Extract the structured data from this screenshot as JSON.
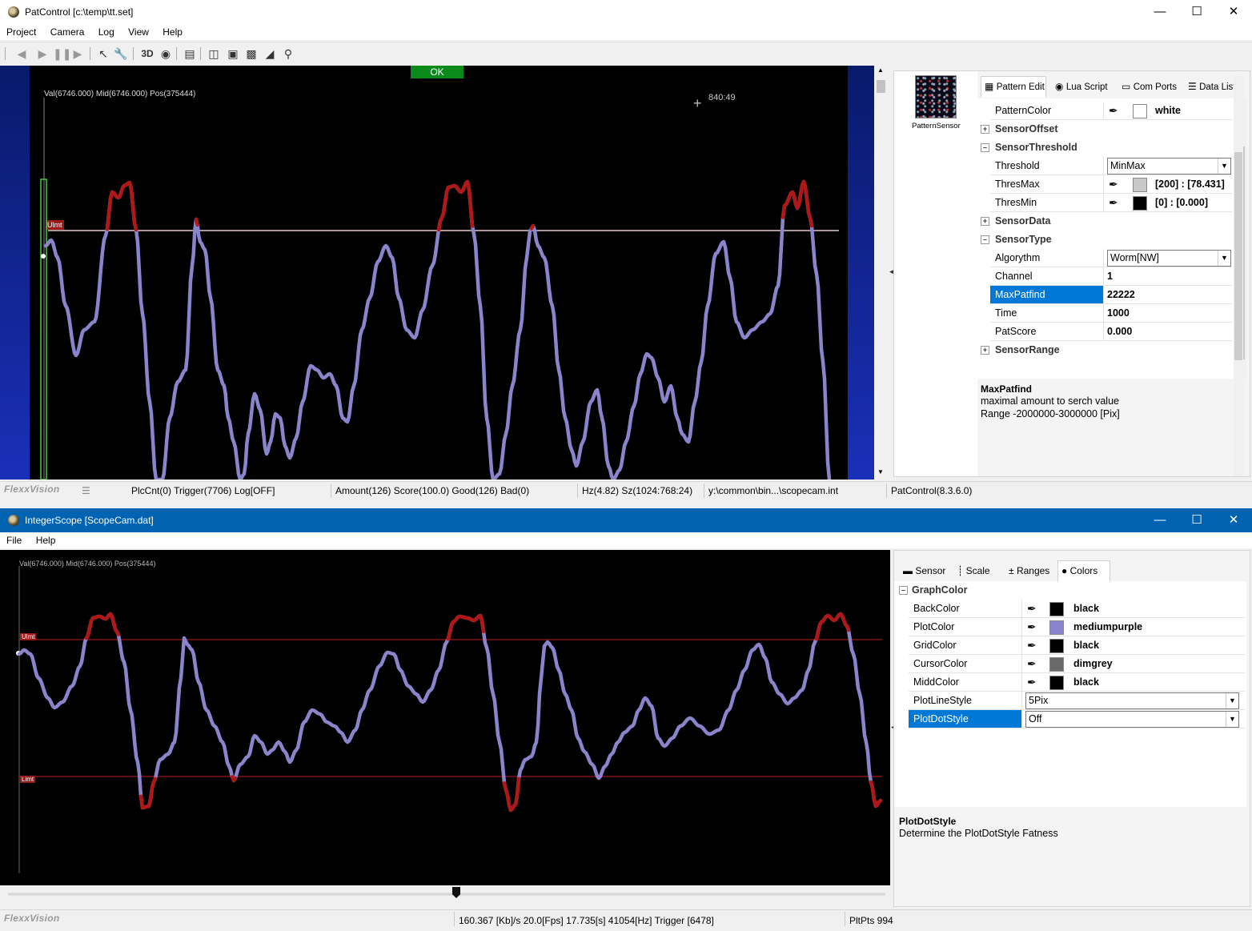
{
  "top": {
    "title": "PatControl [c:\\temp\\tt.set]",
    "menu": [
      "Project",
      "Camera",
      "Log",
      "View",
      "Help"
    ],
    "scope": {
      "ok_label": "OK",
      "cursor_readout": "Val(6746.000) Mid(6746.000) Pos(375444)",
      "coord_readout": "840:49",
      "limit_label": "Ulmt"
    },
    "sensor_thumb_label": "PatternSensor",
    "tabs": [
      "Pattern Edit",
      "Lua Script",
      "Com Ports",
      "Data List"
    ],
    "props": {
      "pattern_color": {
        "name": "PatternColor",
        "value": "white",
        "color": "#ffffff"
      },
      "cat_offset": "SensorOffset",
      "cat_threshold": "SensorThreshold",
      "threshold": {
        "name": "Threshold",
        "value": "MinMax"
      },
      "thresmax": {
        "name": "ThresMax",
        "value": "[200] : [78.431]",
        "color": "#c8c8c8"
      },
      "thresmin": {
        "name": "ThresMin",
        "value": "[0] : [0.000]",
        "color": "#000000"
      },
      "cat_data": "SensorData",
      "cat_type": "SensorType",
      "algorythm": {
        "name": "Algorythm",
        "value": "Worm[NW]"
      },
      "channel": {
        "name": "Channel",
        "value": "1"
      },
      "maxpatfind": {
        "name": "MaxPatfind",
        "value": "22222"
      },
      "time": {
        "name": "Time",
        "value": "1000"
      },
      "patscore": {
        "name": "PatScore",
        "value": "0.000"
      },
      "cat_range": "SensorRange"
    },
    "help": {
      "title": "MaxPatfind",
      "line1": "maximal amount to serch value",
      "line2": "Range -2000000-3000000 [Pix]"
    },
    "status": {
      "brand": "FlexxVision",
      "s1": "PlcCnt(0) Trigger(7706) Log[OFF]",
      "s2": "Amount(126) Score(100.0) Good(126) Bad(0)",
      "s3": "Hz(4.82) Sz(1024:768:24)",
      "s4": "y:\\common\\bin...\\scopecam.int",
      "s5": "PatControl(8.3.6.0)"
    }
  },
  "bottom": {
    "title": "IntegerScope [ScopeCam.dat]",
    "menu": [
      "File",
      "Help"
    ],
    "scope": {
      "cursor_readout": "Val(6746.000) Mid(6746.000) Pos(375444)",
      "upper_label": "Ulmt",
      "lower_label": "Llmt"
    },
    "tabs": [
      "Sensor",
      "Scale",
      "Ranges",
      "Colors"
    ],
    "cat_graphcolor": "GraphColor",
    "props": [
      {
        "name": "BackColor",
        "value": "black",
        "color": "#000000"
      },
      {
        "name": "PlotColor",
        "value": "mediumpurple",
        "color": "#8a84cc"
      },
      {
        "name": "GridColor",
        "value": "black",
        "color": "#000000"
      },
      {
        "name": "CursorColor",
        "value": "dimgrey",
        "color": "#696969"
      },
      {
        "name": "MiddColor",
        "value": "black",
        "color": "#000000"
      }
    ],
    "plotlinestyle": {
      "name": "PlotLineStyle",
      "value": "5Pix"
    },
    "plotdotstyle": {
      "name": "PlotDotStyle",
      "value": "Off"
    },
    "help": {
      "title": "PlotDotStyle",
      "line1": "Determine the PlotDotStyle Fatness"
    },
    "status": {
      "brand": "FlexxVision",
      "s1": "160.367 [Kb]/s 20.0[Fps] 17.735[s] 41054[Hz] Trigger [6478]",
      "s2": "PltPts 994"
    }
  },
  "colors": {
    "plot": "#8a84cc",
    "limit_hit": "#b01818",
    "limit_line": "#9a1a1a",
    "selection": "#0078d7",
    "titlebar_active": "#0063b1",
    "ok_green": "#0a8a1a"
  }
}
